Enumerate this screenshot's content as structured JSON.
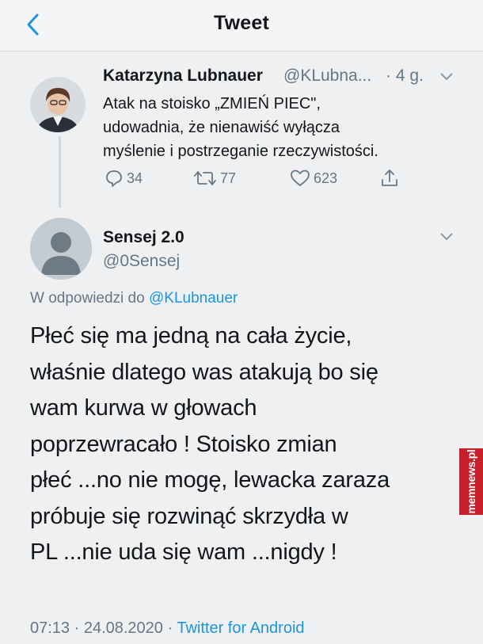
{
  "header": {
    "title": "Tweet"
  },
  "original_tweet": {
    "author_name": "Katarzyna Lubnauer",
    "author_handle": "@KLubna...",
    "time": "· 4 g.",
    "text": "Atak na stoisko „ZMIEŃ PIEC\",\nudowadnia, że nienawiść wyłącza\nmyślenie i postrzeganie rzeczywistości.",
    "replies": "34",
    "retweets": "77",
    "likes": "623"
  },
  "reply_tweet": {
    "author_name": "Sensej 2.0",
    "author_handle": "@0Sensej",
    "reply_prefix": "W odpowiedzi do",
    "reply_mention": "@KLubnauer",
    "text": "Płeć się ma jedną na cała życie,\nwłaśnie dlatego was atakują bo się\nwam kurwa w głowach\npoprzewracało ! Stoisko zmian\npłeć ...no nie mogę, lewacka zaraza\npróbuje się rozwinąć skrzydła w\nPL ...nie uda się wam ...nigdy !",
    "timestamp": "07:13 · 24.08.2020 · ",
    "source": "Twitter for Android"
  },
  "watermark": {
    "text": "memnews.pl"
  },
  "colors": {
    "accent": "#1b95e0",
    "muted": "#657786",
    "watermark_bg": "#c8202a"
  },
  "icons": [
    "back-arrow-icon",
    "chevron-down-icon",
    "reply-icon",
    "retweet-icon",
    "like-icon",
    "share-icon"
  ]
}
